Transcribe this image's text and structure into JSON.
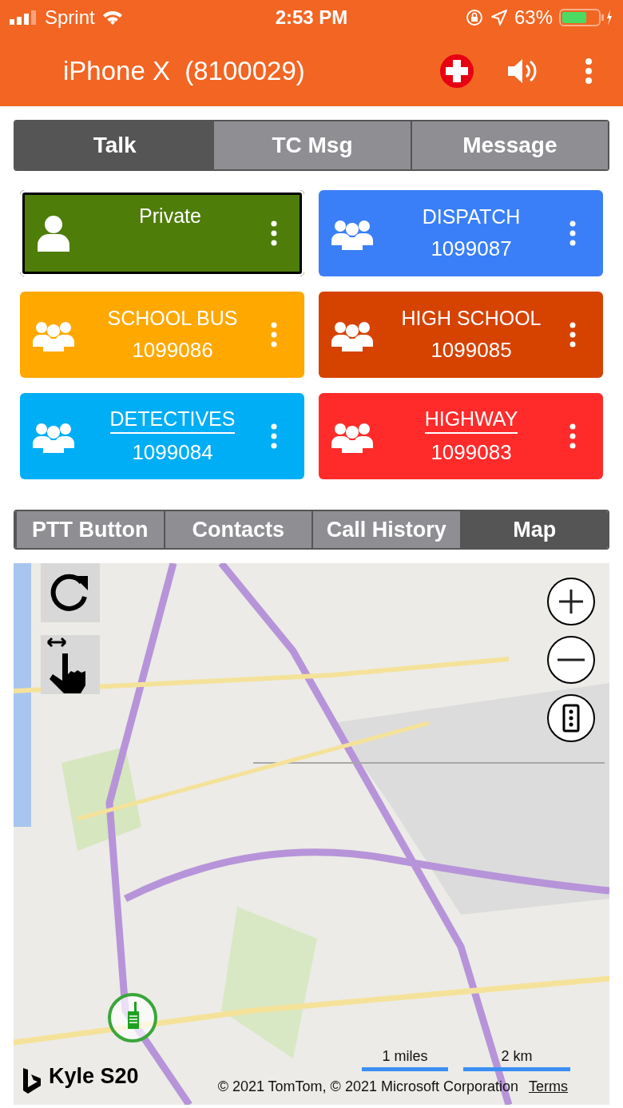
{
  "status_bar": {
    "carrier": "Sprint",
    "time": "2:53 PM",
    "battery": "63%"
  },
  "header": {
    "title": "iPhone X  (8100029)"
  },
  "tabs": [
    {
      "label": "Talk",
      "selected": true
    },
    {
      "label": "TC Msg",
      "selected": false
    },
    {
      "label": "Message",
      "selected": false
    }
  ],
  "channels": [
    {
      "kind": "private",
      "name": "Private",
      "selected": true,
      "underlined": false,
      "color": "#4e7d0a"
    },
    {
      "kind": "group",
      "name": "DISPATCH",
      "number": "1099087",
      "selected": false,
      "underlined": false,
      "color": "#3a7ff7"
    },
    {
      "kind": "group",
      "name": "SCHOOL BUS",
      "number": "1099086",
      "selected": false,
      "underlined": false,
      "color": "#ffa800"
    },
    {
      "kind": "group",
      "name": "HIGH SCHOOL",
      "number": "1099085",
      "selected": false,
      "underlined": false,
      "color": "#d64200"
    },
    {
      "kind": "group",
      "name": "DETECTIVES",
      "number": "1099084",
      "selected": false,
      "underlined": true,
      "color": "#00aef5"
    },
    {
      "kind": "group",
      "name": "HIGHWAY",
      "number": "1099083",
      "selected": false,
      "underlined": true,
      "color": "#ff2b2b"
    }
  ],
  "bottom_tabs": [
    {
      "label": "PTT Button",
      "selected": false
    },
    {
      "label": "Contacts",
      "selected": false
    },
    {
      "label": "Call History",
      "selected": false
    },
    {
      "label": "Map",
      "selected": true
    }
  ],
  "map": {
    "kind": "picture",
    "user_label": "Kyle S20",
    "scale": [
      "1 miles",
      "2 km"
    ],
    "copyright": "© 2021 TomTom, © 2021 Microsoft Corporation",
    "terms": "Terms"
  }
}
